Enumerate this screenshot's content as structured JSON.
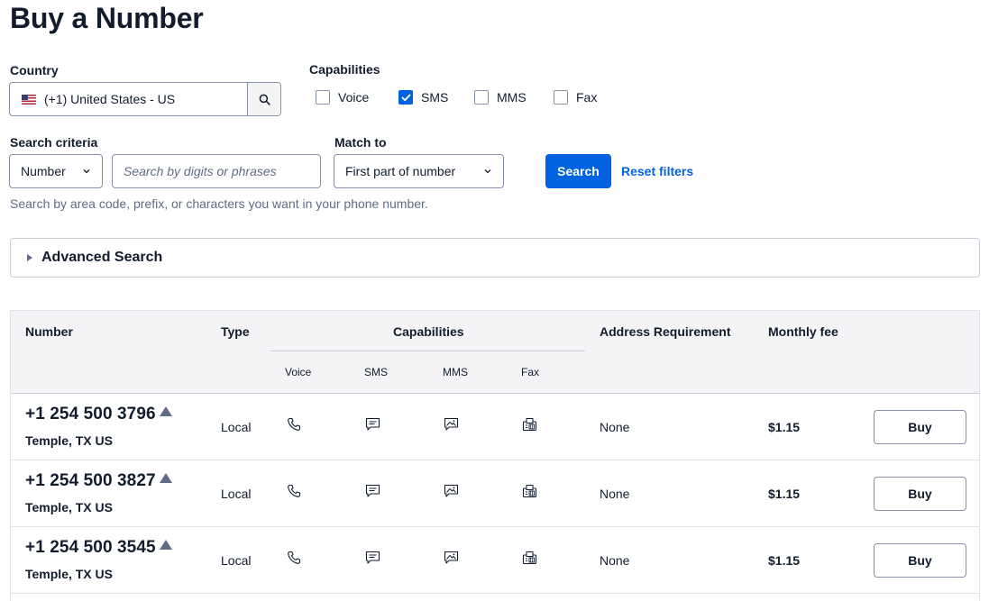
{
  "page_title": "Buy a Number",
  "country": {
    "label": "Country",
    "value": "(+1) United States - US",
    "flag_icon": "us-flag-icon",
    "search_icon": "search-icon"
  },
  "capabilities": {
    "label": "Capabilities",
    "options": [
      {
        "label": "Voice",
        "checked": false
      },
      {
        "label": "SMS",
        "checked": true
      },
      {
        "label": "MMS",
        "checked": false
      },
      {
        "label": "Fax",
        "checked": false
      }
    ]
  },
  "search_criteria": {
    "label": "Search criteria",
    "type_value": "Number",
    "placeholder": "Search by digits or phrases"
  },
  "match_to": {
    "label": "Match to",
    "value": "First part of number"
  },
  "search_button": "Search",
  "reset_button": "Reset filters",
  "help_text": "Search by area code, prefix, or characters you want in your phone number.",
  "advanced_search": "Advanced Search",
  "table": {
    "headers": {
      "number": "Number",
      "type": "Type",
      "capabilities": "Capabilities",
      "voice": "Voice",
      "sms": "SMS",
      "mms": "MMS",
      "fax": "Fax",
      "address": "Address Requirement",
      "fee": "Monthly fee"
    },
    "rows": [
      {
        "number": "+1 254 500 3796",
        "location": "Temple, TX US",
        "type": "Local",
        "address": "None",
        "fee": "$1.15",
        "action": "Buy"
      },
      {
        "number": "+1 254 500 3827",
        "location": "Temple, TX US",
        "type": "Local",
        "address": "None",
        "fee": "$1.15",
        "action": "Buy"
      },
      {
        "number": "+1 254 500 3545",
        "location": "Temple, TX US",
        "type": "Local",
        "address": "None",
        "fee": "$1.15",
        "action": "Buy"
      }
    ]
  },
  "colors": {
    "primary": "#0263e0",
    "text": "#121c2d",
    "muted": "#606b85",
    "border": "#8891aa"
  }
}
